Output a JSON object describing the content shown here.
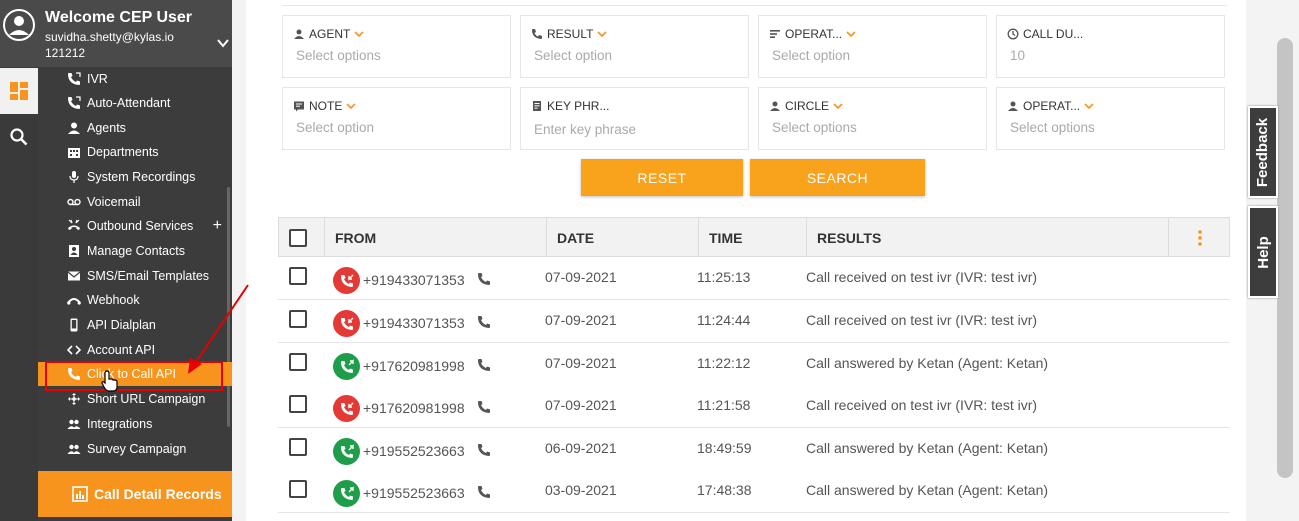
{
  "user": {
    "title": "Welcome CEP User",
    "email": "suvidha.shetty@kylas.io",
    "id": "121212"
  },
  "sidebar": {
    "items": [
      {
        "label": "IVR",
        "icon": "phone-forward-icon"
      },
      {
        "label": "Auto-Attendant",
        "icon": "phone-forward-icon"
      },
      {
        "label": "Agents",
        "icon": "person-icon"
      },
      {
        "label": "Departments",
        "icon": "building-icon"
      },
      {
        "label": "System Recordings",
        "icon": "microphone-icon"
      },
      {
        "label": "Voicemail",
        "icon": "voicemail-icon"
      },
      {
        "label": "Outbound Services",
        "icon": "outbound-icon"
      },
      {
        "label": "Manage Contacts",
        "icon": "contacts-icon"
      },
      {
        "label": "SMS/Email Templates",
        "icon": "mail-icon"
      },
      {
        "label": "Webhook",
        "icon": "webhook-icon"
      },
      {
        "label": "API Dialplan",
        "icon": "mobile-icon"
      },
      {
        "label": "Account API",
        "icon": "code-icon"
      },
      {
        "label": "Click to Call API",
        "icon": "phone-icon"
      },
      {
        "label": "Short URL Campaign",
        "icon": "share-icon"
      },
      {
        "label": "Integrations",
        "icon": "people-icon"
      },
      {
        "label": "Survey Campaign",
        "icon": "people-icon"
      }
    ],
    "outbound_plus": "+",
    "cdr_label": "Call Detail Records"
  },
  "filters": {
    "agent": {
      "label": "AGENT",
      "value": "Select options"
    },
    "result": {
      "label": "RESULT",
      "value": "Select option"
    },
    "operator1": {
      "label": "OPERAT...",
      "value": "Select option"
    },
    "call_duration": {
      "label": "CALL DU...",
      "value": "10"
    },
    "note": {
      "label": "NOTE",
      "value": "Select option"
    },
    "key_phrase": {
      "label": "KEY PHR...",
      "value": "Enter key phrase"
    },
    "circle": {
      "label": "CIRCLE",
      "value": "Select options"
    },
    "operator2": {
      "label": "OPERAT...",
      "value": "Select options"
    }
  },
  "buttons": {
    "reset": "RESET",
    "search": "SEARCH"
  },
  "table": {
    "headers": {
      "from": "FROM",
      "date": "DATE",
      "time": "TIME",
      "results": "RESULTS"
    },
    "rows": [
      {
        "from": "+919433071353",
        "date": "07-09-2021",
        "time": "11:25:13",
        "result": "Call received on test ivr (IVR: test ivr)",
        "status": "missed"
      },
      {
        "from": "+919433071353",
        "date": "07-09-2021",
        "time": "11:24:44",
        "result": "Call received on test ivr (IVR: test ivr)",
        "status": "missed"
      },
      {
        "from": "+917620981998",
        "date": "07-09-2021",
        "time": "11:22:12",
        "result": "Call answered by Ketan (Agent: Ketan)",
        "status": "answered"
      },
      {
        "from": "+917620981998",
        "date": "07-09-2021",
        "time": "11:21:58",
        "result": "Call received on test ivr (IVR: test ivr)",
        "status": "missed"
      },
      {
        "from": "+919552523663",
        "date": "06-09-2021",
        "time": "18:49:59",
        "result": "Call answered by Ketan (Agent: Ketan)",
        "status": "answered"
      },
      {
        "from": "+919552523663",
        "date": "03-09-2021",
        "time": "17:48:38",
        "result": "Call answered by Ketan (Agent: Ketan)",
        "status": "answered"
      }
    ]
  },
  "side_tabs": {
    "feedback": "Feedback",
    "help": "Help"
  },
  "colors": {
    "accent": "#f7941d",
    "missed": "#e53935",
    "answered": "#1e9e4a",
    "annotation": "#e60000"
  }
}
